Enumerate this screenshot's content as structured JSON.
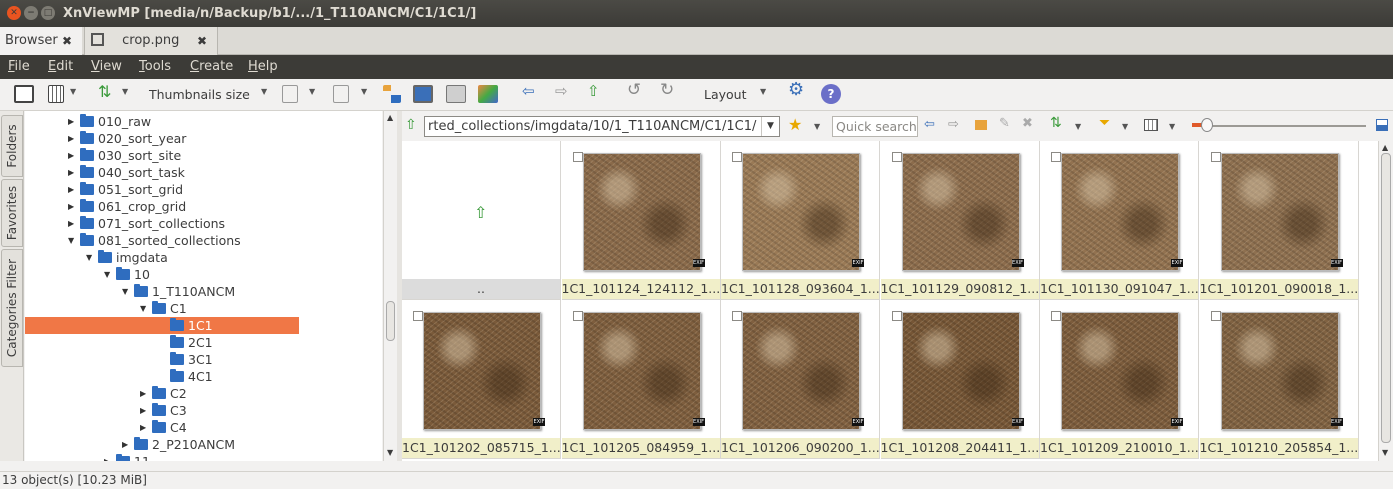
{
  "window": {
    "title": "XnViewMP [media/n/Backup/b1/.../1_T110ANCM/C1/1C1/]"
  },
  "tabs": [
    {
      "label": "Browser"
    },
    {
      "label": "crop.png"
    }
  ],
  "menu": [
    "File",
    "Edit",
    "View",
    "Tools",
    "Create",
    "Help"
  ],
  "toolbar": {
    "thumbnails_size": "Thumbnails size",
    "layout": "Layout"
  },
  "side_tabs": [
    "Folders",
    "Favorites",
    "Categories Filter"
  ],
  "tree": [
    {
      "label": "010_raw",
      "expanded": false
    },
    {
      "label": "020_sort_year",
      "expanded": false
    },
    {
      "label": "030_sort_site",
      "expanded": false
    },
    {
      "label": "040_sort_task",
      "expanded": false
    },
    {
      "label": "051_sort_grid",
      "expanded": false
    },
    {
      "label": "061_crop_grid",
      "expanded": false
    },
    {
      "label": "071_sort_collections",
      "expanded": false
    },
    {
      "label": "081_sorted_collections",
      "expanded": true
    },
    {
      "label": "imgdata",
      "expanded": true
    },
    {
      "label": "10",
      "expanded": true
    },
    {
      "label": "1_T110ANCM",
      "expanded": true
    },
    {
      "label": "C1",
      "expanded": true
    },
    {
      "label": "1C1",
      "selected": true
    },
    {
      "label": "2C1"
    },
    {
      "label": "3C1"
    },
    {
      "label": "4C1"
    },
    {
      "label": "C2",
      "expanded": false
    },
    {
      "label": "C3",
      "expanded": false
    },
    {
      "label": "C4",
      "expanded": false
    },
    {
      "label": "2_P210ANCM",
      "expanded": false
    },
    {
      "label": "11",
      "expanded": false
    }
  ],
  "path": {
    "value": "rted_collections/imgdata/10/1_T110ANCM/C1/1C1/"
  },
  "search": {
    "placeholder": "Quick search"
  },
  "parent_label": "..",
  "thumbnails": [
    {
      "caption": "1C1_101124_124112_1....",
      "badge": "EXIF"
    },
    {
      "caption": "1C1_101128_093604_1....",
      "badge": "EXIF"
    },
    {
      "caption": "1C1_101129_090812_1....",
      "badge": "EXIF"
    },
    {
      "caption": "1C1_101130_091047_1....",
      "badge": "EXIF"
    },
    {
      "caption": "1C1_101201_090018_1....",
      "badge": "EXIF"
    },
    {
      "caption": "1C1_101202_085715_1....",
      "badge": "EXIF"
    },
    {
      "caption": "1C1_101205_084959_1....",
      "badge": "EXIF"
    },
    {
      "caption": "1C1_101206_090200_1....",
      "badge": "EXIF"
    },
    {
      "caption": "1C1_101208_204411_1....",
      "badge": "EXIF"
    },
    {
      "caption": "1C1_101209_210010_1....",
      "badge": "EXIF"
    },
    {
      "caption": "1C1_101210_205854_1....",
      "badge": "EXIF"
    }
  ],
  "status": {
    "text": "13 object(s) [10.23 MiB]"
  },
  "colors": {
    "selection": "#f07746",
    "folder": "#2f6dbf",
    "caption_bg": "#f1efc9",
    "menubar": "#3c3b37"
  }
}
